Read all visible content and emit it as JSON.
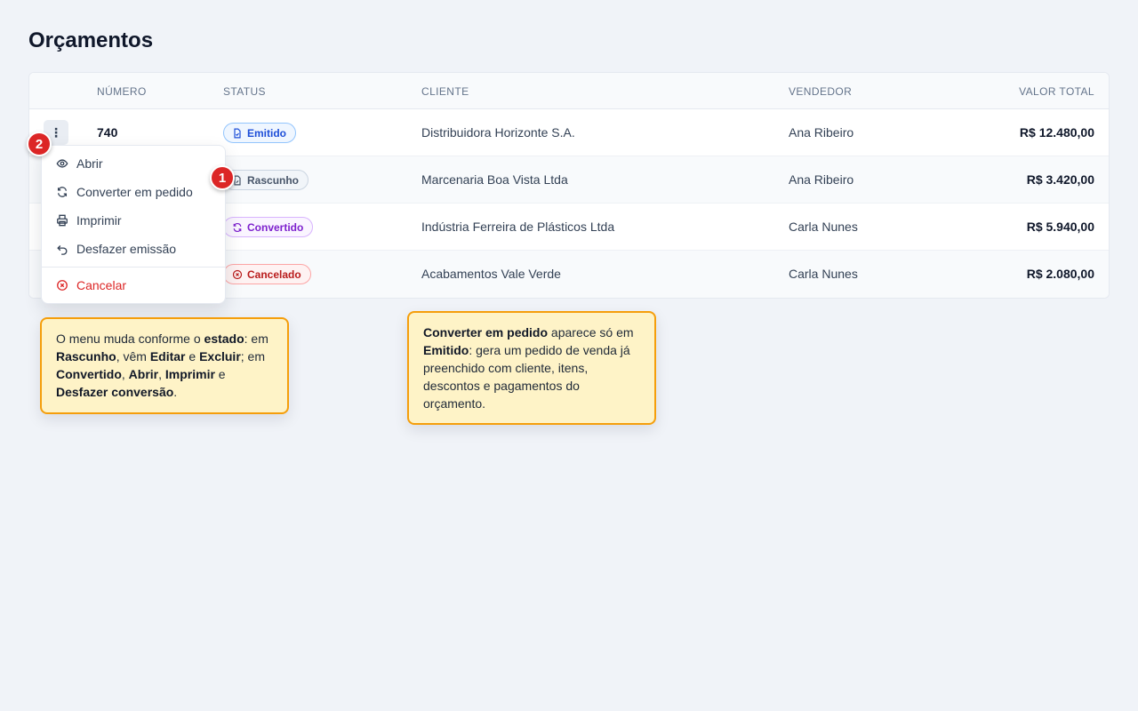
{
  "page": {
    "title": "Orçamentos"
  },
  "table": {
    "headers": {
      "numero": "NÚMERO",
      "status": "STATUS",
      "cliente": "CLIENTE",
      "vendedor": "VENDEDOR",
      "valor_total": "VALOR TOTAL"
    },
    "rows": [
      {
        "numero": "740",
        "status": "Emitido",
        "cliente": "Distribuidora Horizonte S.A.",
        "vendedor": "Ana Ribeiro",
        "valor_total": "R$ 12.480,00"
      },
      {
        "numero": "",
        "status": "Rascunho",
        "cliente": "Marcenaria Boa Vista Ltda",
        "vendedor": "Ana Ribeiro",
        "valor_total": "R$ 3.420,00"
      },
      {
        "numero": "",
        "status": "Convertido",
        "cliente": "Indústria Ferreira de Plásticos Ltda",
        "vendedor": "Carla Nunes",
        "valor_total": "R$ 5.940,00"
      },
      {
        "numero": "",
        "status": "Cancelado",
        "cliente": "Acabamentos Vale Verde",
        "vendedor": "Carla Nunes",
        "valor_total": "R$ 2.080,00"
      }
    ]
  },
  "row_menu": {
    "kebab_glyph": "⋮",
    "items": [
      {
        "label": "Abrir",
        "icon": "eye-icon"
      },
      {
        "label": "Converter em pedido",
        "icon": "refresh-icon"
      },
      {
        "label": "Imprimir",
        "icon": "printer-icon"
      },
      {
        "label": "Desfazer emissão",
        "icon": "undo-icon"
      },
      {
        "label": "Cancelar",
        "icon": "x-circle-icon",
        "danger": true
      }
    ]
  },
  "markers": {
    "one": "1",
    "two": "2"
  },
  "notes": {
    "left": {
      "p1": "O menu muda conforme o ",
      "b1": "estado",
      "p2": ": em ",
      "b2": "Rascunho",
      "p3": ", vêm ",
      "b3": "Editar",
      "p4": " e ",
      "b4": "Excluir",
      "p5": "; em ",
      "b5": "Convertido",
      "p6": ", ",
      "b6": "Abrir",
      "p7": ", ",
      "b7": "Imprimir",
      "p8": " e ",
      "b8": "Desfazer conversão",
      "p9": "."
    },
    "right": {
      "b1": "Converter em pedido",
      "p1": " aparece só em ",
      "b2": "Emitido",
      "p2": ": gera um pedido de venda já preenchido com cliente, itens, descontos e pagamentos do orçamento."
    }
  },
  "colors": {
    "emitido": "#1d4ed8",
    "rascunho": "#475569",
    "convertido": "#7e22ce",
    "cancelado": "#b91c1c",
    "marker": "#dc2626",
    "note_bg": "#fef3c7",
    "note_border": "#f59e0b"
  }
}
